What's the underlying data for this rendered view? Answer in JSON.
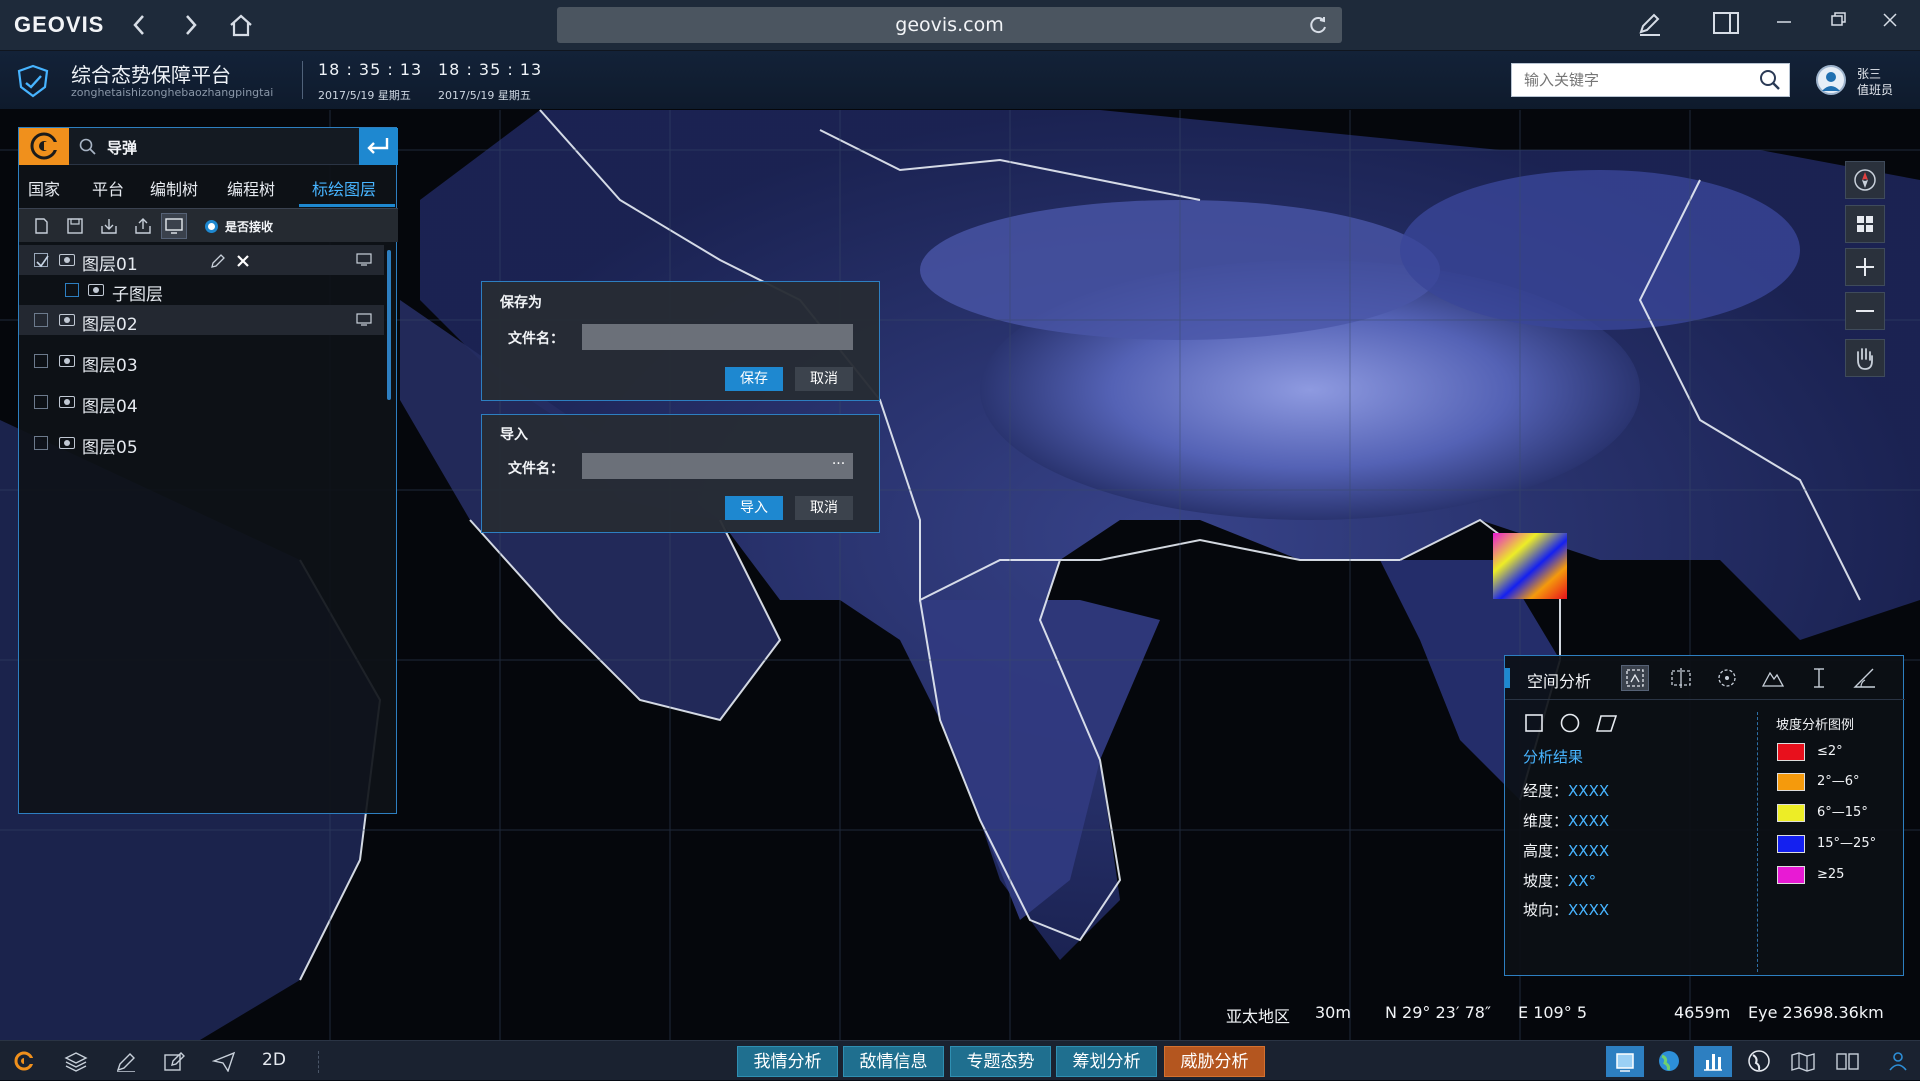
{
  "browser": {
    "logo": "GEOVIS",
    "url": "geovis.com"
  },
  "app": {
    "title": "综合态势保障平台",
    "subtitle": "zonghetaishizonghebaozhangpingtai",
    "clocks": [
      {
        "time": "18 : 35 : 13",
        "date": "2017/5/19 星期五"
      },
      {
        "time": "18 : 35 : 13",
        "date": "2017/5/19 星期五"
      }
    ],
    "search_placeholder": "输入关键字",
    "user": {
      "name": "张三",
      "role": "值班员"
    }
  },
  "left_panel": {
    "search_value": "导弹",
    "tabs": [
      "国家",
      "平台",
      "编制树",
      "编程树",
      "标绘图层"
    ],
    "active_tab": "标绘图层",
    "receive_label": "是否接收",
    "layers": [
      {
        "label": "图层01",
        "checked": true
      },
      {
        "label": "子图层",
        "checked": false
      },
      {
        "label": "图层02",
        "checked": false
      },
      {
        "label": "图层03",
        "checked": false
      },
      {
        "label": "图层04",
        "checked": false
      },
      {
        "label": "图层05",
        "checked": false
      }
    ]
  },
  "dialogs": {
    "save": {
      "title": "保存为",
      "field_label": "文件名：",
      "value": "",
      "confirm": "保存",
      "cancel": "取消"
    },
    "import": {
      "title": "导入",
      "field_label": "文件名：",
      "value": "",
      "browse": "···",
      "confirm": "导入",
      "cancel": "取消"
    }
  },
  "analysis": {
    "title": "空间分析",
    "result_title": "分析结果",
    "rows": [
      {
        "label": "经度：",
        "value": "XXXX"
      },
      {
        "label": "维度：",
        "value": "XXXX"
      },
      {
        "label": "高度：",
        "value": "XXXX"
      },
      {
        "label": "坡度：",
        "value": "XX°"
      },
      {
        "label": "坡向：",
        "value": "XXXX"
      }
    ],
    "legend_title": "坡度分析图例",
    "legend": [
      {
        "label": "≤2°",
        "color": "#e8101c"
      },
      {
        "label": "2°—6°",
        "color": "#f59a0c"
      },
      {
        "label": "6°—15°",
        "color": "#eded26"
      },
      {
        "label": "15°—25°",
        "color": "#1420f0"
      },
      {
        "label": "≥25",
        "color": "#e81ad4"
      }
    ]
  },
  "status": {
    "region": "亚太地区",
    "scale": "30m",
    "lat": "N  29° 23′ 78″",
    "lon": "E 109° 5",
    "altitude": "4659m",
    "eye": "Eye 23698.36km"
  },
  "bottom": {
    "mode_label": "2D",
    "tabs": [
      "我情分析",
      "敌情信息",
      "专题态势",
      "筹划分析",
      "威胁分析"
    ]
  },
  "colors": {
    "accent": "#1e88d0",
    "highlight": "#47b4ff",
    "warn": "#b4561f"
  }
}
